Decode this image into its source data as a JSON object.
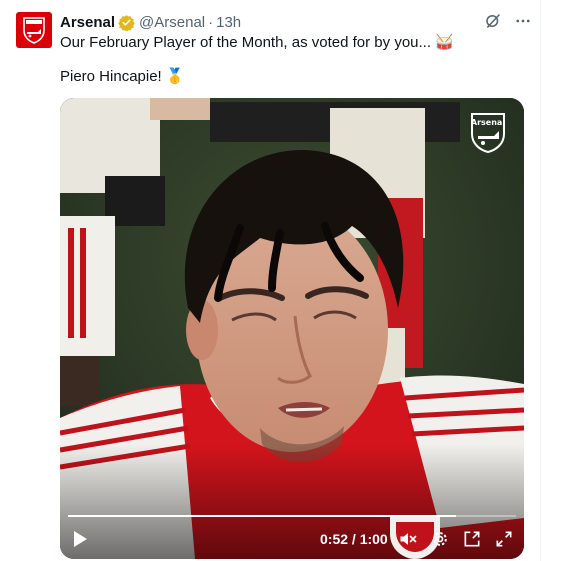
{
  "tweet": {
    "author_name": "Arsenal",
    "handle": "@Arsenal",
    "separator": "·",
    "time": "13h",
    "text_line1": "Our February Player of the Month, as voted for by you...",
    "text_line1_emoji": "🥁",
    "text_line2": "Piero Hincapie!",
    "text_line2_emoji": "🥇"
  },
  "video": {
    "time_display": "0:52 / 1:00",
    "progress": 0.867,
    "watermark_text": "Arsenal"
  },
  "icons": {
    "verified": "verified-badge-icon",
    "grok": "grok-icon",
    "more": "more-icon",
    "play": "play-icon",
    "volume": "volume-icon",
    "settings": "settings-gear-icon",
    "popout": "popout-icon",
    "fullscreen": "fullscreen-icon"
  },
  "colors": {
    "arsenal_red": "#db0007",
    "verified_gold": "#e2b719",
    "secondary_text": "#536471"
  }
}
